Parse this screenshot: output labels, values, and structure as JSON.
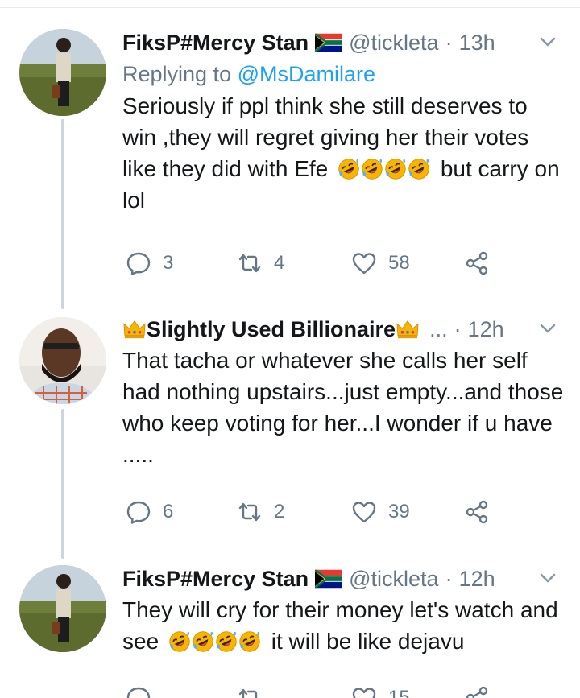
{
  "tweets": [
    {
      "name": "FiksP#Mercy Stan",
      "handle": "@tickleta",
      "time": "13h",
      "replying_prefix": "Replying to",
      "replying_to": "@MsDamilare",
      "text_before": "Seriously if ppl think she still deserves to win ,they will regret giving her their votes like they did with Efe",
      "text_after": "but carry on lol",
      "emoji": "rolling-on-floor-laughing",
      "emoji_count": 4,
      "replies": "3",
      "retweets": "4",
      "likes": "58"
    },
    {
      "name": "Slightly Used Billionaire",
      "ellipsis": "...",
      "time": "12h",
      "text": "That tacha or whatever she calls her self had nothing upstairs...just empty...and those who keep voting for her...I wonder if u have .....",
      "replies": "6",
      "retweets": "2",
      "likes": "39"
    },
    {
      "name": "FiksP#Mercy Stan",
      "handle": "@tickleta",
      "time": "12h",
      "text_before": "They will cry for their money let's watch and see",
      "text_after": "it will be like dejavu",
      "emoji": "rolling-on-floor-laughing",
      "emoji_count": 4,
      "likes": "15"
    }
  ],
  "icons": {
    "reply": "reply-icon",
    "retweet": "retweet-icon",
    "like": "heart-icon",
    "share": "share-icon",
    "menu": "chevron-down-icon",
    "flag": "south-africa-flag-icon",
    "crown": "crown-icon"
  },
  "colors": {
    "link": "#1da1f2",
    "secondary": "#657786",
    "thread_line": "#ccd6dd",
    "text": "#14171a"
  }
}
